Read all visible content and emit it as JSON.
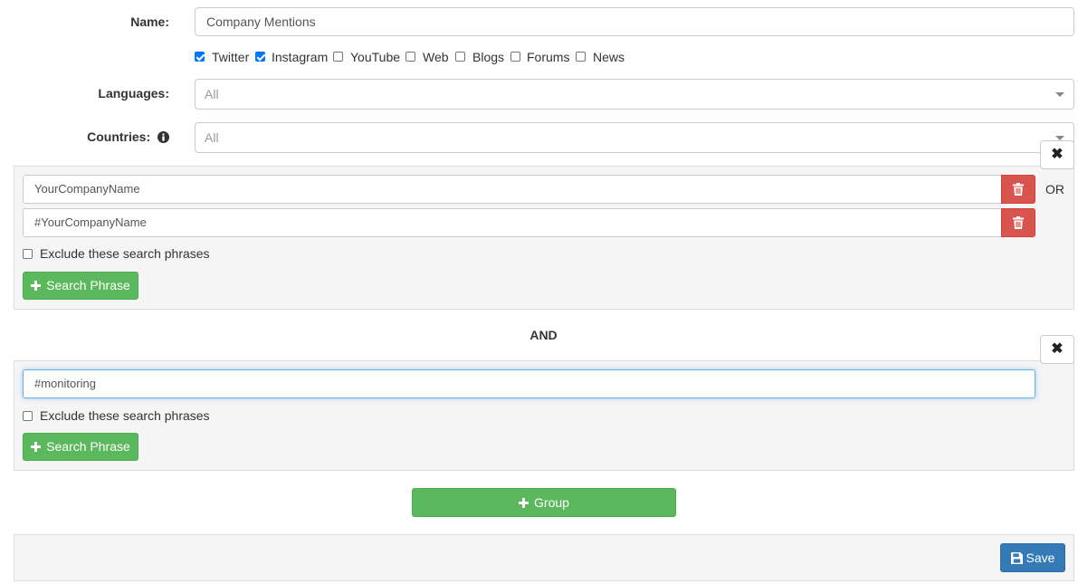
{
  "form": {
    "name_label": "Name:",
    "name_value": "Company Mentions",
    "sources": [
      {
        "label": "Twitter",
        "checked": true
      },
      {
        "label": "Instagram",
        "checked": true
      },
      {
        "label": "YouTube",
        "checked": false
      },
      {
        "label": "Web",
        "checked": false
      },
      {
        "label": "Blogs",
        "checked": false
      },
      {
        "label": "Forums",
        "checked": false
      },
      {
        "label": "News",
        "checked": false
      }
    ],
    "languages_label": "Languages:",
    "languages_value": "All",
    "countries_label": "Countries:",
    "countries_value": "All"
  },
  "groups": [
    {
      "phrases": [
        "YourCompanyName",
        "#YourCompanyName"
      ],
      "connector": "OR",
      "exclude_label": "Exclude these search phrases",
      "exclude_checked": false,
      "add_phrase_label": "Search Phrase"
    },
    {
      "phrases": [
        "#monitoring"
      ],
      "exclude_label": "Exclude these search phrases",
      "exclude_checked": false,
      "add_phrase_label": "Search Phrase"
    }
  ],
  "group_connector": "AND",
  "close_symbol": "✖",
  "add_group_label": "Group",
  "save_label": "Save",
  "colors": {
    "green": "#5cb85c",
    "red": "#d9534f",
    "blue": "#337ab7",
    "checkbox_blue": "#0075ff"
  }
}
